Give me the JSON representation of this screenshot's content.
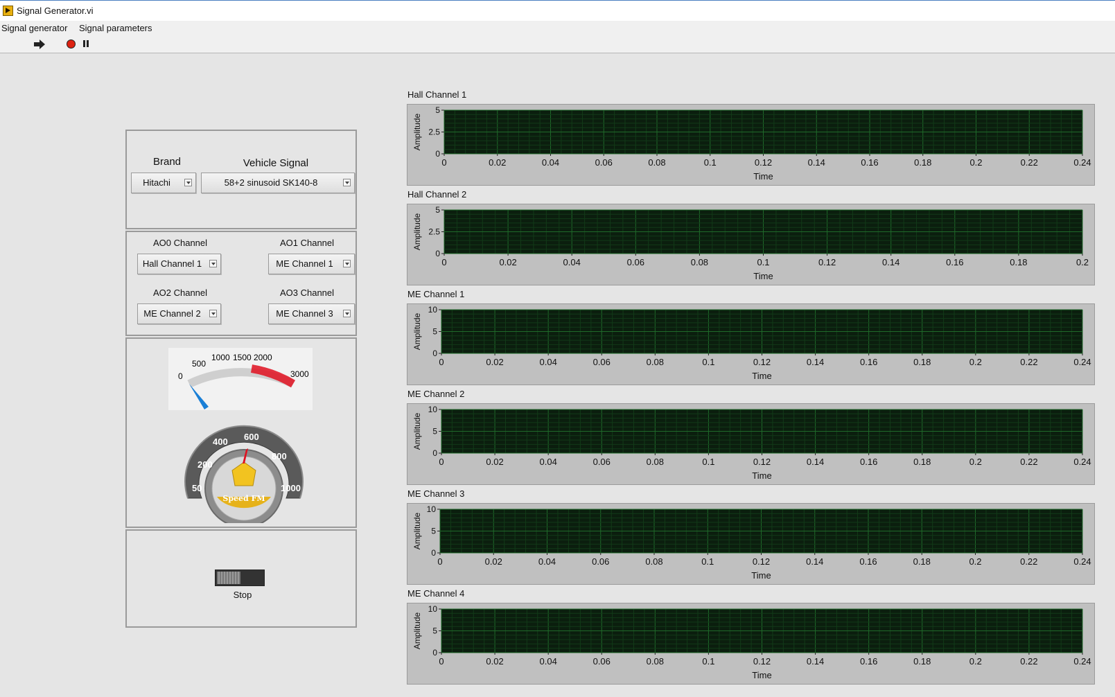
{
  "window": {
    "title": "Signal Generator.vi"
  },
  "menu": [
    "Signal generator",
    "Signal parameters"
  ],
  "controls": {
    "brand_label": "Brand",
    "brand_value": "Hitachi",
    "vehicle_signal_label": "Vehicle Signal",
    "vehicle_signal_value": "58+2 sinusoid SK140-8",
    "ao0_label": "AO0 Channel",
    "ao0_value": "Hall Channel 1",
    "ao1_label": "AO1 Channel",
    "ao1_value": "ME Channel 1",
    "ao2_label": "AO2 Channel",
    "ao2_value": "ME Channel 2",
    "ao3_label": "AO3 Channel",
    "ao3_value": "ME Channel 3",
    "stop_label": "Stop"
  },
  "gauge": {
    "ticks": [
      "0",
      "500",
      "1000",
      "1500",
      "2000",
      "3000"
    ],
    "min": 0,
    "max": 3000,
    "value": 0,
    "arc_color": "#cccccc",
    "alarm_color": "#e01020",
    "needle_color": "#1a7fd6"
  },
  "knob": {
    "ticks": [
      "50",
      "200",
      "400",
      "600",
      "800",
      "1000"
    ],
    "brand_text": "Speed FM",
    "value": 600,
    "accent": "#e6b21a"
  },
  "chart_data": [
    {
      "type": "line",
      "title": "Hall Channel 1",
      "xlabel": "Time",
      "ylabel": "Amplitude",
      "xlim": [
        0,
        0.24
      ],
      "ylim": [
        0,
        5
      ],
      "xticks": [
        "0",
        "0.02",
        "0.04",
        "0.06",
        "0.08",
        "0.1",
        "0.12",
        "0.14",
        "0.16",
        "0.18",
        "0.2",
        "0.22",
        "0.24"
      ],
      "yticks": [
        "0",
        "2.5",
        "5"
      ],
      "series": []
    },
    {
      "type": "line",
      "title": "Hall Channel 2",
      "xlabel": "Time",
      "ylabel": "Amplitude",
      "xlim": [
        0,
        0.2
      ],
      "ylim": [
        0,
        5
      ],
      "xticks": [
        "0",
        "0.02",
        "0.04",
        "0.06",
        "0.08",
        "0.1",
        "0.12",
        "0.14",
        "0.16",
        "0.18",
        "0.2"
      ],
      "yticks": [
        "0",
        "2.5",
        "5"
      ],
      "series": []
    },
    {
      "type": "line",
      "title": "ME Channel 1",
      "xlabel": "Time",
      "ylabel": "Amplitude",
      "xlim": [
        0,
        0.24
      ],
      "ylim": [
        0,
        10
      ],
      "xticks": [
        "0",
        "0.02",
        "0.04",
        "0.06",
        "0.08",
        "0.1",
        "0.12",
        "0.14",
        "0.16",
        "0.18",
        "0.2",
        "0.22",
        "0.24"
      ],
      "yticks": [
        "0",
        "5",
        "10"
      ],
      "series": []
    },
    {
      "type": "line",
      "title": "ME Channel 2",
      "xlabel": "Time",
      "ylabel": "Amplitude",
      "xlim": [
        0,
        0.24
      ],
      "ylim": [
        0,
        10
      ],
      "xticks": [
        "0",
        "0.02",
        "0.04",
        "0.06",
        "0.08",
        "0.1",
        "0.12",
        "0.14",
        "0.16",
        "0.18",
        "0.2",
        "0.22",
        "0.24"
      ],
      "yticks": [
        "0",
        "5",
        "10"
      ],
      "series": []
    },
    {
      "type": "line",
      "title": "ME Channel 3",
      "xlabel": "Time",
      "ylabel": "Amplitude",
      "xlim": [
        0,
        0.24
      ],
      "ylim": [
        0,
        10
      ],
      "xticks": [
        "0",
        "0.02",
        "0.04",
        "0.06",
        "0.08",
        "0.1",
        "0.12",
        "0.14",
        "0.16",
        "0.18",
        "0.2",
        "0.22",
        "0.24"
      ],
      "yticks": [
        "0",
        "5",
        "10"
      ],
      "series": []
    },
    {
      "type": "line",
      "title": "ME Channel 4",
      "xlabel": "Time",
      "ylabel": "Amplitude",
      "xlim": [
        0,
        0.24
      ],
      "ylim": [
        0,
        10
      ],
      "xticks": [
        "0",
        "0.02",
        "0.04",
        "0.06",
        "0.08",
        "0.1",
        "0.12",
        "0.14",
        "0.16",
        "0.18",
        "0.2",
        "0.22",
        "0.24"
      ],
      "yticks": [
        "0",
        "5",
        "10"
      ],
      "series": []
    }
  ],
  "colors": {
    "plot_bg": "#0b1e0e",
    "grid_major": "#1f6a2a",
    "grid_minor": "#123a18",
    "frame": "#c0c0c0"
  }
}
